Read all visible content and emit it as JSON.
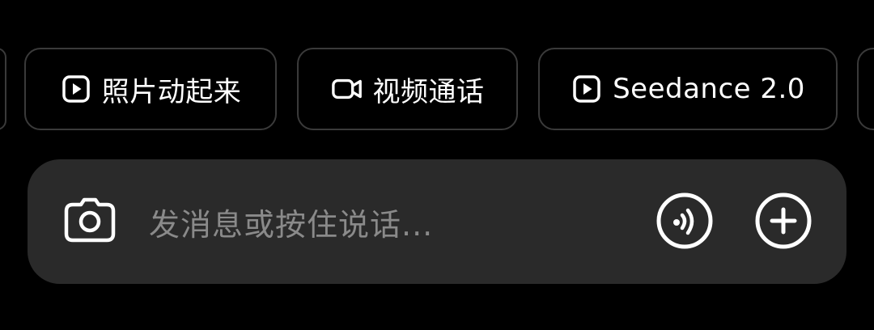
{
  "quick_actions": [
    {
      "label": "照片动起来",
      "icon": "play-square-icon"
    },
    {
      "label": "视频通话",
      "icon": "video-camera-icon"
    },
    {
      "label": "Seedance 2.0",
      "icon": "play-square-icon"
    }
  ],
  "input_bar": {
    "placeholder": "发消息或按住说话...",
    "left_icon": "camera-icon",
    "right_icons": [
      "voice-waves-icon",
      "plus-circle-icon"
    ]
  },
  "colors": {
    "background": "#000000",
    "chip_border": "#3a3a3a",
    "input_bg": "#2a2a2a",
    "placeholder": "#8a8a8a",
    "icon": "#ffffff"
  }
}
